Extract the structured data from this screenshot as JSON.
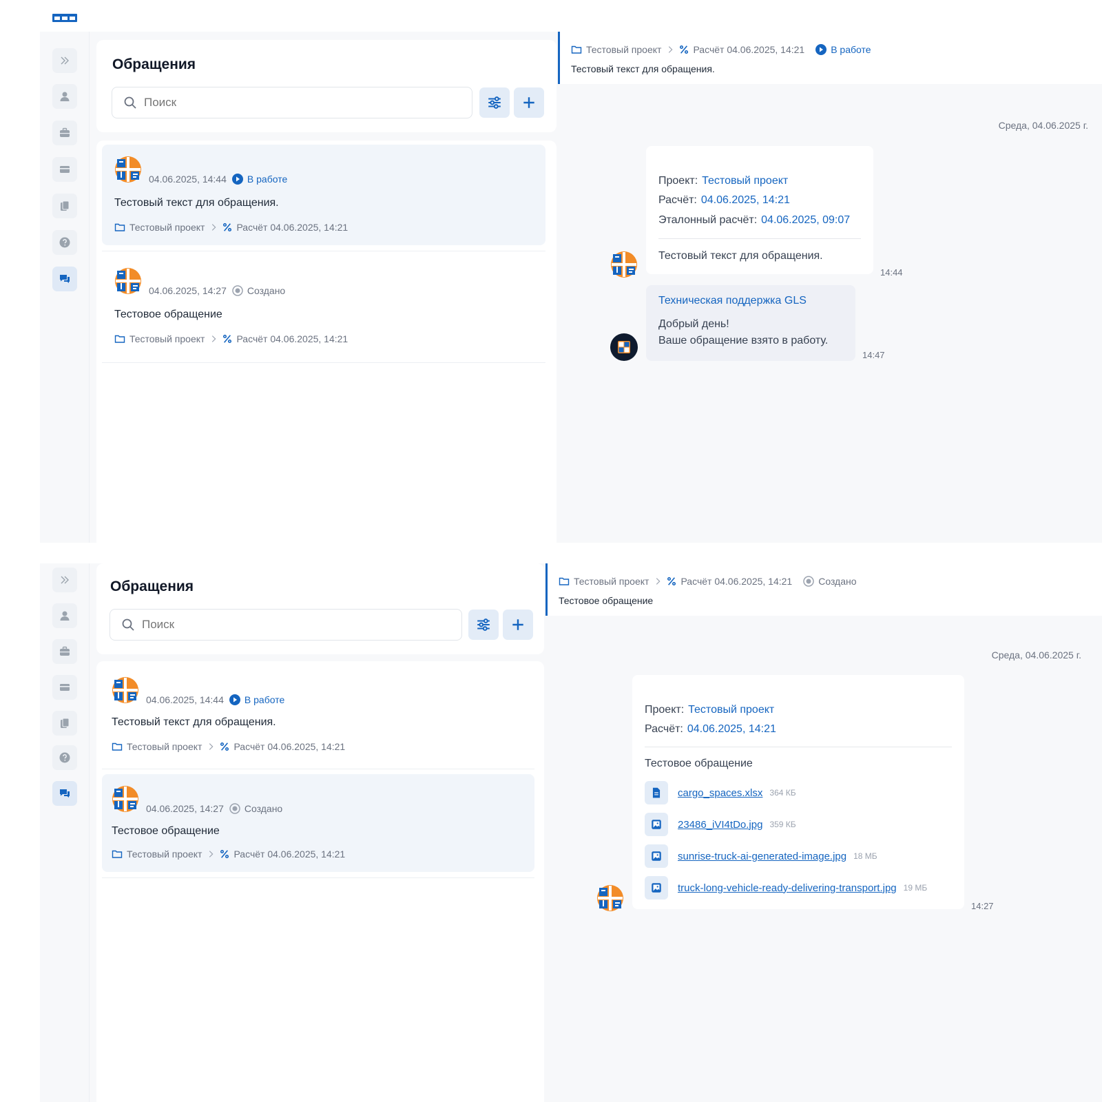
{
  "colors": {
    "accent": "#1565c0",
    "orange": "#f28c28",
    "muted": "#6b7280"
  },
  "list": {
    "title": "Обращения",
    "search_placeholder": "Поиск"
  },
  "tickets": [
    {
      "date": "04.06.2025, 14:44",
      "status": "В работе",
      "text": "Тестовый текст для обращения.",
      "project": "Тестовый проект",
      "calc": "Расчёт 04.06.2025, 14:21"
    },
    {
      "date": "04.06.2025, 14:27",
      "status": "Создано",
      "text": "Тестовое обращение",
      "project": "Тестовый проект",
      "calc": "Расчёт 04.06.2025, 14:21"
    }
  ],
  "chat1": {
    "header": {
      "project": "Тестовый проект",
      "calc": "Расчёт 04.06.2025, 14:21",
      "status": "В работе",
      "text": "Тестовый текст для обращения."
    },
    "date_divider": "Среда, 04.06.2025 г.",
    "msg1": {
      "project_label": "Проект:",
      "project_value": "Тестовый проект",
      "calc_label": "Расчёт:",
      "calc_value": "04.06.2025, 14:21",
      "ref_label": "Эталонный расчёт:",
      "ref_value": "04.06.2025, 09:07",
      "text": "Тестовый текст для обращения.",
      "time": "14:44"
    },
    "msg2": {
      "sender": "Техническая поддержка GLS",
      "line1": "Добрый день!",
      "line2": "Ваше обращение взято в работу.",
      "time": "14:47"
    }
  },
  "chat2": {
    "header": {
      "project": "Тестовый проект",
      "calc": "Расчёт 04.06.2025, 14:21",
      "status": "Создано",
      "text": "Тестовое обращение"
    },
    "date_divider": "Среда, 04.06.2025 г.",
    "msg1": {
      "project_label": "Проект:",
      "project_value": "Тестовый проект",
      "calc_label": "Расчёт:",
      "calc_value": "04.06.2025, 14:21",
      "text": "Тестовое обращение",
      "time": "14:27",
      "attachments": [
        {
          "name": "cargo_spaces.xlsx",
          "size": "364 КБ",
          "icon": "document-icon"
        },
        {
          "name": "23486_iVI4tDo.jpg",
          "size": "359 КБ",
          "icon": "image-icon"
        },
        {
          "name": "sunrise-truck-ai-generated-image.jpg",
          "size": "18 МБ",
          "icon": "image-icon"
        },
        {
          "name": "truck-long-vehicle-ready-delivering-transport.jpg",
          "size": "19 МБ",
          "icon": "image-icon"
        }
      ]
    }
  }
}
